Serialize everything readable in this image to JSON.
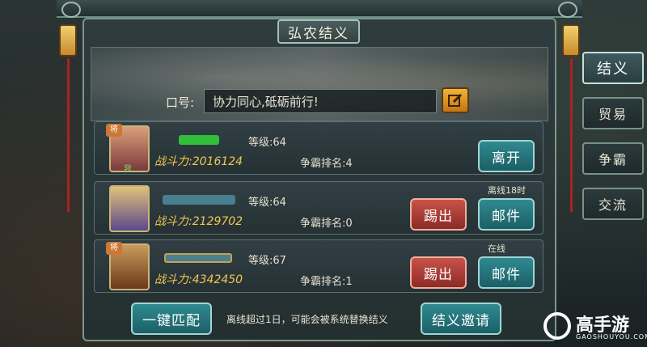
{
  "panel": {
    "title": "弘农结义",
    "motto_label": "口号:",
    "motto_value": "协力同心,砥砺前行!"
  },
  "members": [
    {
      "avatar_tag": "将",
      "me_badge": "我",
      "level": "等级:64",
      "power": "战斗力:2016124",
      "rank": "争霸排名:4",
      "status": "",
      "action_primary": "离开",
      "action_secondary": ""
    },
    {
      "avatar_tag": "",
      "me_badge": "",
      "level": "等级:64",
      "power": "战斗力:2129702",
      "rank": "争霸排名:0",
      "status": "离线18时",
      "action_primary": "邮件",
      "action_secondary": "踢出"
    },
    {
      "avatar_tag": "将",
      "me_badge": "",
      "level": "等级:67",
      "power": "战斗力:4342450",
      "rank": "争霸排名:1",
      "status": "在线",
      "action_primary": "邮件",
      "action_secondary": "踢出"
    }
  ],
  "footer": {
    "match_button": "一键匹配",
    "note": "离线超过1日，可能会被系统替换结义",
    "invite_button": "结义邀请"
  },
  "side_tabs": [
    "结义",
    "贸易",
    "争霸",
    "交流"
  ],
  "watermark": {
    "text": "高手游",
    "sub": "GAOSHOUYOU.COM"
  },
  "colors": {
    "accent_teal": "#2f8a90",
    "danger_red": "#c8534a",
    "power_gold": "#f2c750",
    "edit_orange": "#f3b23a"
  }
}
